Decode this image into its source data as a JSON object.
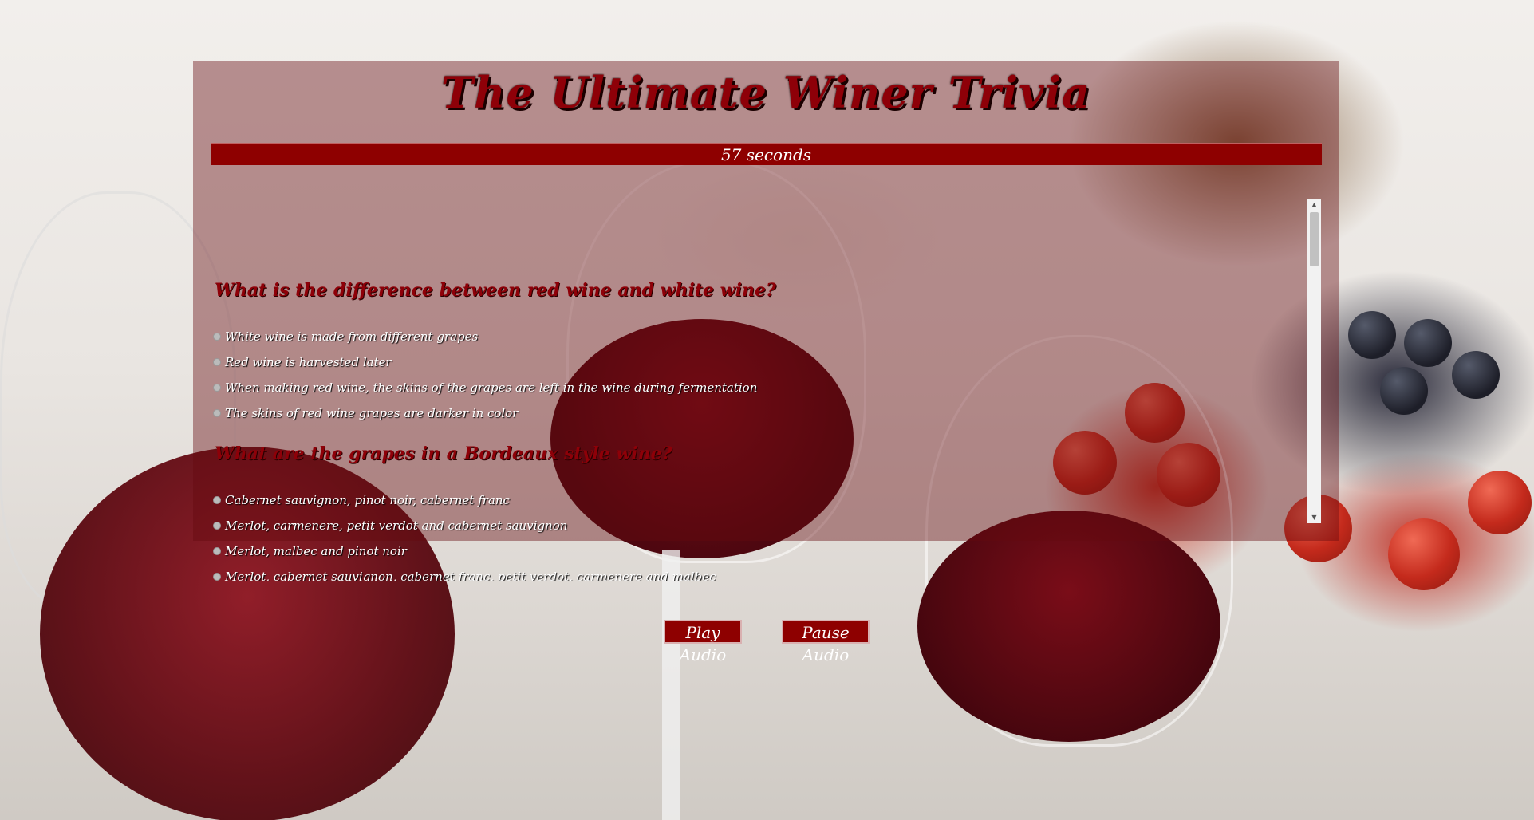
{
  "app": {
    "title": "The Ultimate Winer Trivia",
    "timer_text": "57 seconds"
  },
  "questions": [
    {
      "question": "What is the difference between red wine and white wine?",
      "answers": [
        "White wine is made from different grapes",
        "Red wine is harvested later",
        "When making red wine, the skins of the grapes are left in the wine during fermentation",
        "The skins of red wine grapes are darker in color"
      ]
    },
    {
      "question": "What are the grapes in a Bordeaux style wine?",
      "answers": [
        "Cabernet sauvignon, pinot noir, cabernet franc",
        "Merlot, carmenere, petit verdot and cabernet sauvignon",
        "Merlot, malbec and pinot noir",
        "Merlot, cabernet sauvignon, cabernet franc, petit verdot, carmenere and malbec"
      ]
    }
  ],
  "controls": {
    "play_label": "Play Audio",
    "pause_label": "Pause Audio"
  },
  "colors": {
    "accent": "#8e0000",
    "title": "#8e0008"
  }
}
